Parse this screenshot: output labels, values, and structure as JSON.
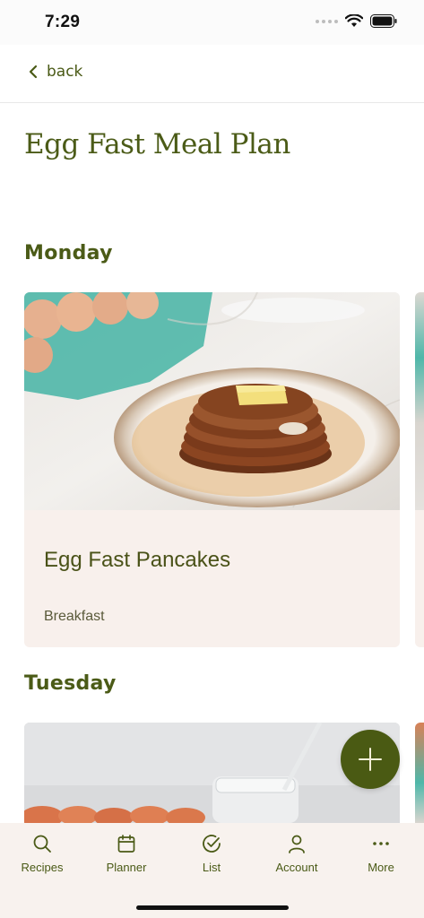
{
  "status": {
    "time": "7:29"
  },
  "nav": {
    "back_label": "back"
  },
  "page": {
    "title": "Egg Fast Meal Plan"
  },
  "days": [
    {
      "name": "Monday",
      "recipe_title": "Egg Fast Pancakes",
      "meal_type": "Breakfast"
    },
    {
      "name": "Tuesday"
    }
  ],
  "tabs": [
    {
      "label": "Recipes",
      "icon": "search-icon"
    },
    {
      "label": "Planner",
      "icon": "calendar-icon"
    },
    {
      "label": "List",
      "icon": "check-circle-icon"
    },
    {
      "label": "Account",
      "icon": "person-icon"
    },
    {
      "label": "More",
      "icon": "more-icon"
    }
  ],
  "colors": {
    "accent": "#4b5b17",
    "card_bg": "#f8f0ec",
    "tab_bar_bg": "#f8f2ee"
  }
}
